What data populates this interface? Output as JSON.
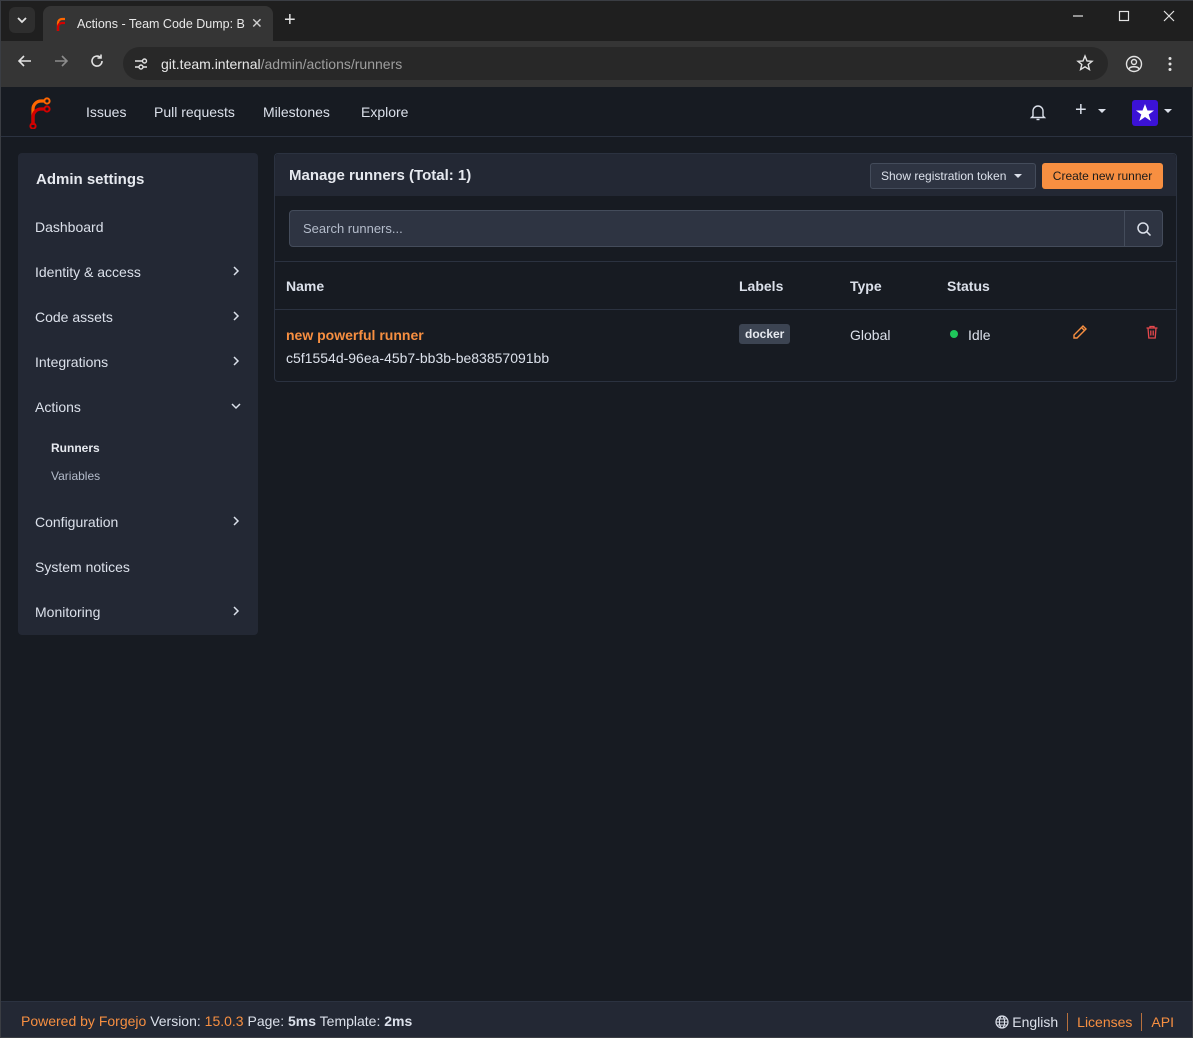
{
  "browser": {
    "tab_title": "Actions - Team Code Dump: Beyond coding. We Forge.",
    "url_host": "git.team.internal",
    "url_path": "/admin/actions/runners"
  },
  "nav": {
    "items": [
      "Issues",
      "Pull requests",
      "Milestones",
      "Explore"
    ]
  },
  "sidebar": {
    "title": "Admin settings",
    "items": {
      "dashboard": "Dashboard",
      "identity": "Identity & access",
      "code_assets": "Code assets",
      "integrations": "Integrations",
      "actions": "Actions",
      "runners": "Runners",
      "variables": "Variables",
      "configuration": "Configuration",
      "system_notices": "System notices",
      "monitoring": "Monitoring"
    }
  },
  "main": {
    "title": "Manage runners (Total: 1)",
    "show_token_label": "Show registration token",
    "create_runner_label": "Create new runner",
    "search_placeholder": "Search runners...",
    "columns": [
      "Name",
      "Labels",
      "Type",
      "Status"
    ],
    "runners": [
      {
        "name": "new powerful runner",
        "uuid": "c5f1554d-96ea-45b7-bb3b-be83857091bb",
        "label": "docker",
        "type": "Global",
        "status": "Idle"
      }
    ]
  },
  "footer": {
    "powered_by": "Powered by Forgejo",
    "version_label": "Version:",
    "version": "15.0.3",
    "page_label": "Page:",
    "page_time": "5ms",
    "template_label": "Template:",
    "template_time": "2ms",
    "language": "English",
    "licenses": "Licenses",
    "api": "API"
  },
  "colors": {
    "accent": "#f78f41",
    "background": "#171b22",
    "panel": "#232834",
    "status_idle": "#1fc75a",
    "delete": "#e5484d"
  }
}
